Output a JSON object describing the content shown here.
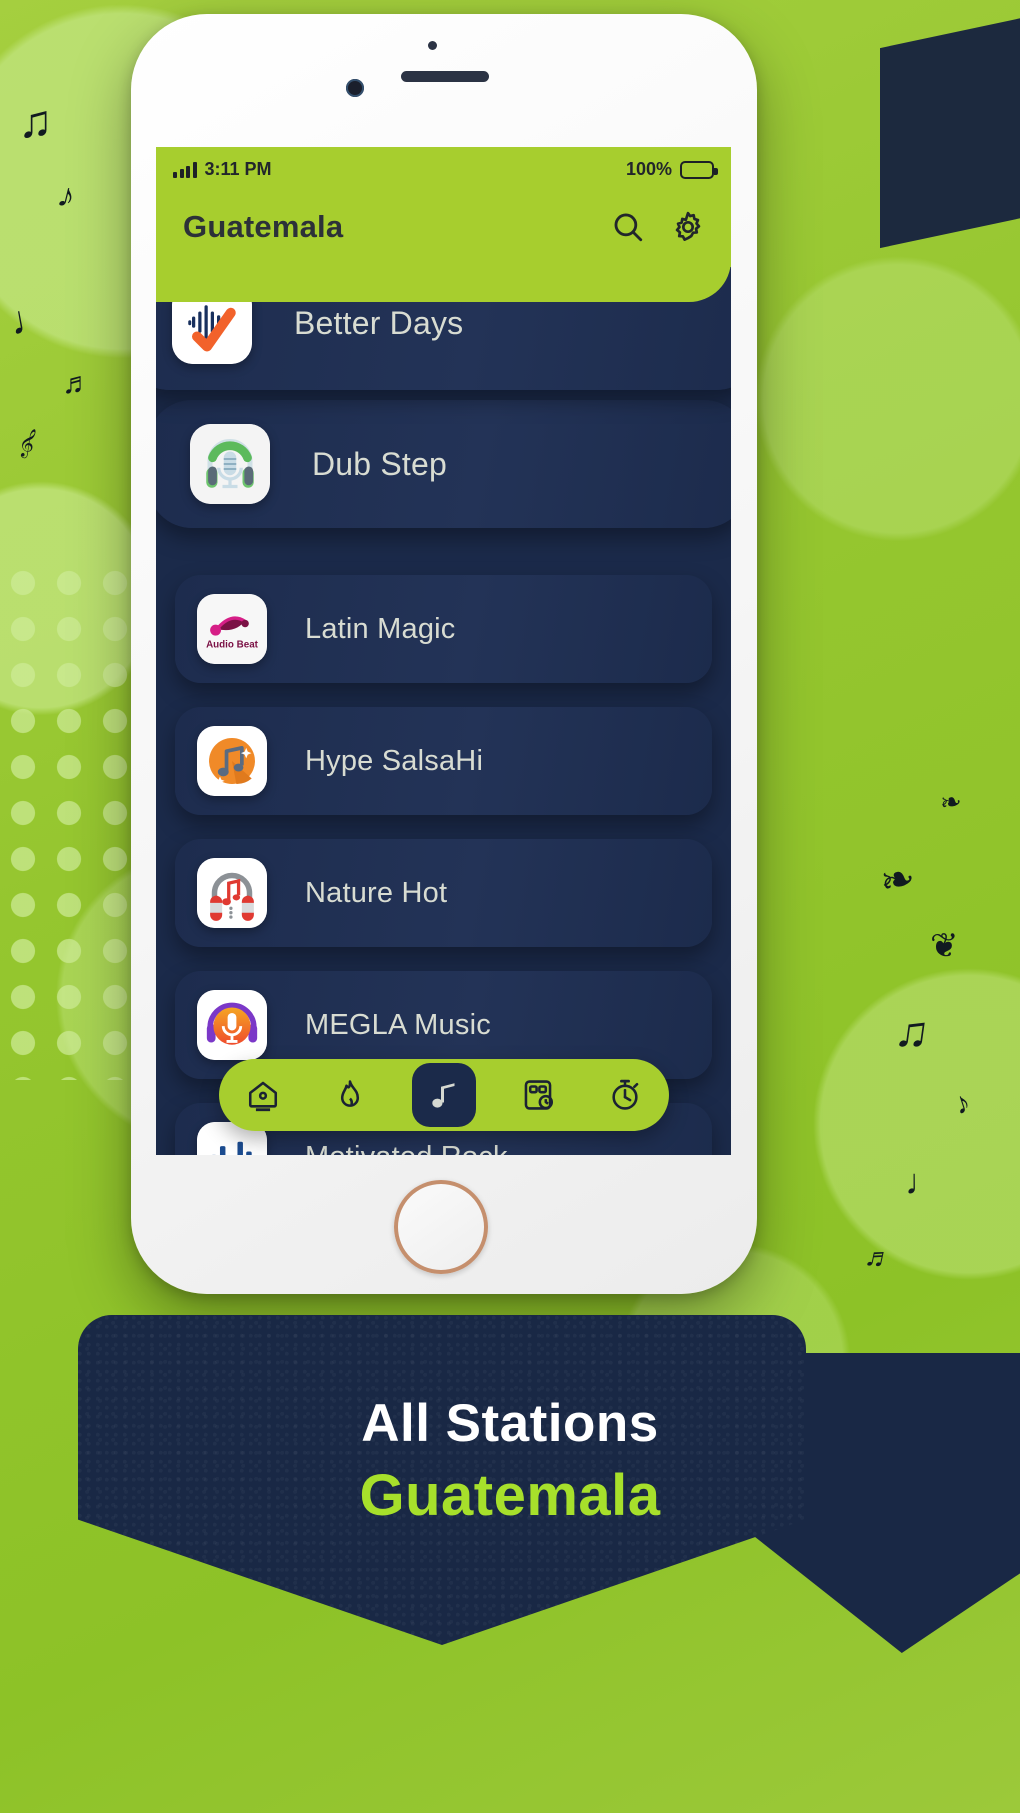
{
  "status_bar": {
    "time": "3:11 PM",
    "battery_percent": "100%",
    "signal_icon": "signal-bars-icon",
    "battery_icon": "battery-full-icon"
  },
  "app_bar": {
    "title": "Guatemala",
    "search_icon": "search-icon",
    "settings_icon": "gear-icon"
  },
  "stations": [
    {
      "name": "Better Days",
      "icon": "waveform-check-icon"
    },
    {
      "name": "Dub Step",
      "icon": "headphone-mic-icon"
    },
    {
      "name": "Latin Magic",
      "icon": "audio-beat-icon",
      "icon_label": "Audio Beat"
    },
    {
      "name": "Hype SalsaHi",
      "icon": "orange-music-notes-icon"
    },
    {
      "name": "Nature Hot",
      "icon": "headphones-note-icon"
    },
    {
      "name": "MEGLA Music",
      "icon": "mic-headphone-circle-icon"
    },
    {
      "name": "Motivated Rock",
      "icon": "equalizer-bars-icon"
    }
  ],
  "bottom_nav": [
    {
      "name": "home",
      "icon": "home-icon",
      "active": false
    },
    {
      "name": "trending",
      "icon": "flame-icon",
      "active": false
    },
    {
      "name": "music",
      "icon": "music-note-icon",
      "active": true
    },
    {
      "name": "recent",
      "icon": "grid-clock-icon",
      "active": false
    },
    {
      "name": "timer",
      "icon": "stopwatch-icon",
      "active": false
    }
  ],
  "footer": {
    "line1": "All Stations",
    "line2": "Guatemala"
  },
  "colors": {
    "brand_green": "#a7ce2e",
    "accent_green": "#a7e02b",
    "card_navy": "#1d2c4e",
    "screen_navy": "#1b2a4a",
    "footer_navy": "#192845",
    "text_light": "#d8dcd2"
  },
  "decor": {
    "notes": [
      "♫",
      "♪",
      "♩",
      "♬",
      "𝄞",
      "❧",
      "❦",
      "♫",
      "♪",
      "♩",
      "♬",
      "❧"
    ]
  }
}
